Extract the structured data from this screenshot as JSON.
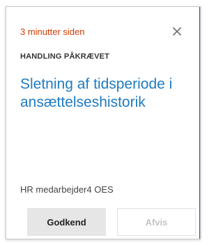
{
  "notification": {
    "timestamp": "3 minutter siden",
    "close_icon": "close-icon",
    "category_label": "HANDLING PÅKRÆVET",
    "title": "Sletning af tidsperiode i ansættelseshistorik",
    "author": "HR medarbejder4 OES"
  },
  "actions": {
    "approve_label": "Godkend",
    "reject_label": "Afvis"
  },
  "colors": {
    "timestamp": "#d83b01",
    "title": "#1f7bc1",
    "approve_bg": "#e6e6e6",
    "reject_text_disabled": "#c4c4c4"
  }
}
